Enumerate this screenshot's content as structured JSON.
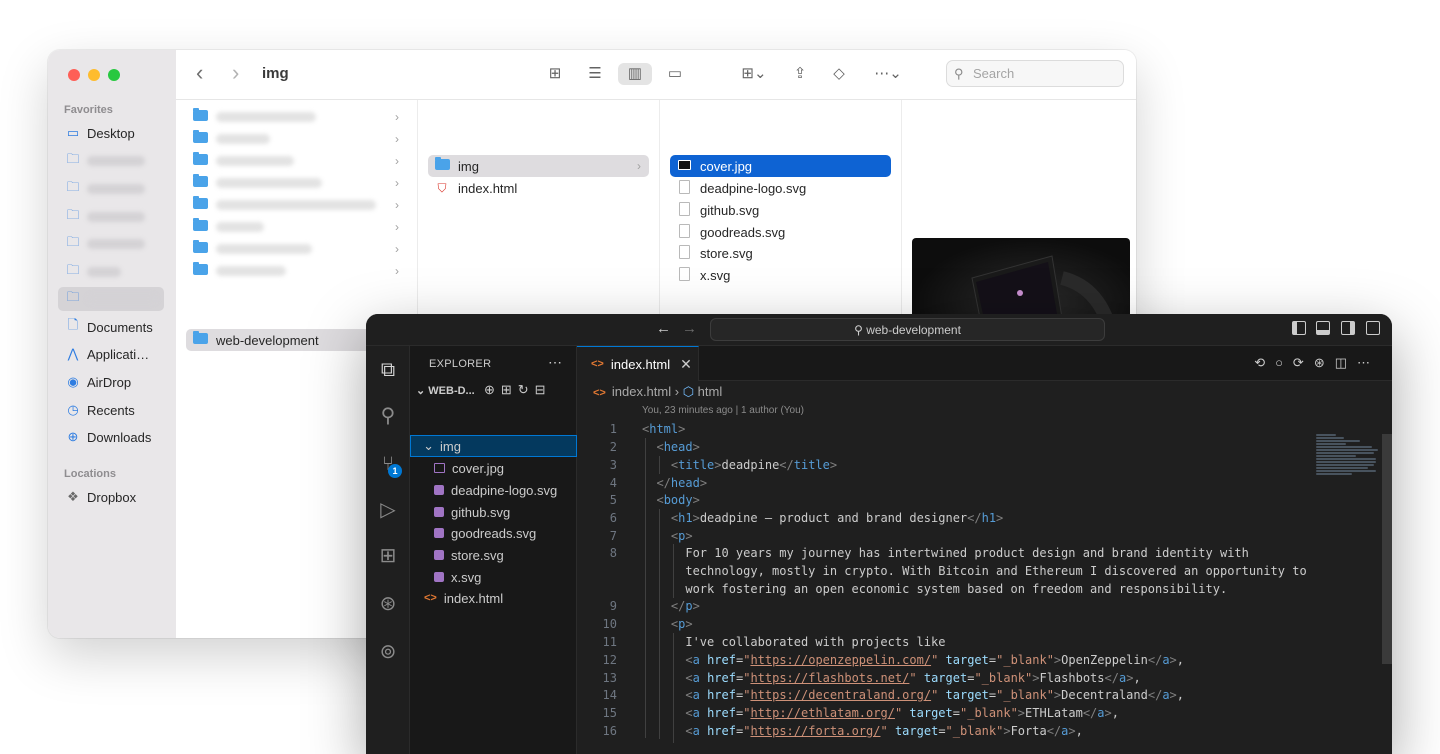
{
  "finder": {
    "title": "img",
    "search_placeholder": "Search",
    "sidebar": {
      "favorites_header": "Favorites",
      "desktop": "Desktop",
      "documents": "Documents",
      "applications": "Applicati…",
      "airdrop": "AirDrop",
      "recents": "Recents",
      "downloads": "Downloads",
      "locations_header": "Locations",
      "dropbox": "Dropbox"
    },
    "column1": {
      "selected_folder": "web-development"
    },
    "column2": {
      "items": [
        "img",
        "index.html"
      ]
    },
    "column3": {
      "items": [
        "cover.jpg",
        "deadpine-logo.svg",
        "github.svg",
        "goodreads.svg",
        "store.svg",
        "x.svg"
      ]
    }
  },
  "vscode": {
    "command_center": "web-development",
    "explorer": {
      "title": "EXPLORER",
      "section": "WEB-D...",
      "folder": "img",
      "files": [
        "cover.jpg",
        "deadpine-logo.svg",
        "github.svg",
        "goodreads.svg",
        "store.svg",
        "x.svg"
      ],
      "root_file": "index.html"
    },
    "tab": {
      "label": "index.html"
    },
    "breadcrumb": {
      "file": "index.html",
      "symbol": "html"
    },
    "blame": "You, 23 minutes ago | 1 author (You)",
    "badge_count": "1",
    "code": {
      "line_numbers": [
        "1",
        "2",
        "3",
        "4",
        "5",
        "6",
        "7",
        "8",
        "",
        "",
        "9",
        "10",
        "11",
        "12",
        "13",
        "14",
        "15",
        "16"
      ],
      "text": {
        "l6": "deadpine – product and brand designer",
        "l3": "deadpine",
        "l8a": "For 10 years my journey has intertwined product design and brand identity with",
        "l8b": "technology, mostly in crypto. With Bitcoin and Ethereum I discovered an opportunity to",
        "l8c": "work fostering an open economic system based on freedom and responsibility.",
        "l11": "I've collaborated with projects like",
        "links": [
          {
            "url": "https://openzeppelin.com/",
            "label": "OpenZeppelin"
          },
          {
            "url": "https://flashbots.net/",
            "label": "Flashbots"
          },
          {
            "url": "https://decentraland.org/",
            "label": "Decentraland"
          },
          {
            "url": "http://ethlatam.org/",
            "label": "ETHLatam"
          },
          {
            "url": "https://forta.org/",
            "label": "Forta"
          }
        ]
      }
    }
  }
}
